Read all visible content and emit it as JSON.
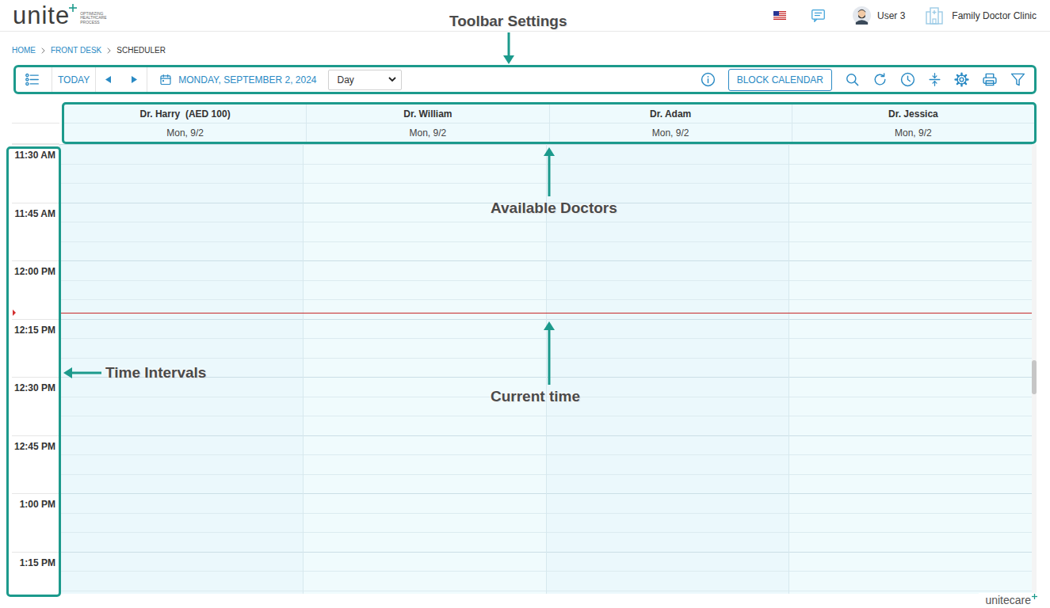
{
  "header": {
    "logo": "unite",
    "logo_tagline": "OPTIMIZING HEALTHCARE PROCESS",
    "user": "User 3",
    "clinic": "Family Doctor Clinic"
  },
  "breadcrumb": [
    {
      "label": "HOME",
      "selected": false
    },
    {
      "label": "FRONT DESK",
      "selected": false
    },
    {
      "label": "SCHEDULER",
      "selected": true
    }
  ],
  "toolbar": {
    "today": "TODAY",
    "date": "MONDAY, SEPTEMBER 2, 2024",
    "view": "Day",
    "block_button": "BLOCK CALENDAR"
  },
  "doctors": [
    {
      "name": "Dr. Harry  (AED 100)",
      "date": "Mon, 9/2"
    },
    {
      "name": "Dr. William",
      "date": "Mon, 9/2"
    },
    {
      "name": "Dr. Adam",
      "date": "Mon, 9/2"
    },
    {
      "name": "Dr. Jessica",
      "date": "Mon, 9/2"
    }
  ],
  "time_slots": [
    "11:30 AM",
    "11:45 AM",
    "12:00 PM",
    "12:15 PM",
    "12:30 PM",
    "12:45 PM",
    "1:00 PM",
    "1:15 PM"
  ],
  "current_time": {
    "level": 0.362
  },
  "annotations": [
    {
      "text": "Toolbar Settings"
    },
    {
      "text": "Available Doctors"
    },
    {
      "text": "Current time"
    },
    {
      "text": "Time Intervals"
    }
  ],
  "watermark": "unitecare"
}
